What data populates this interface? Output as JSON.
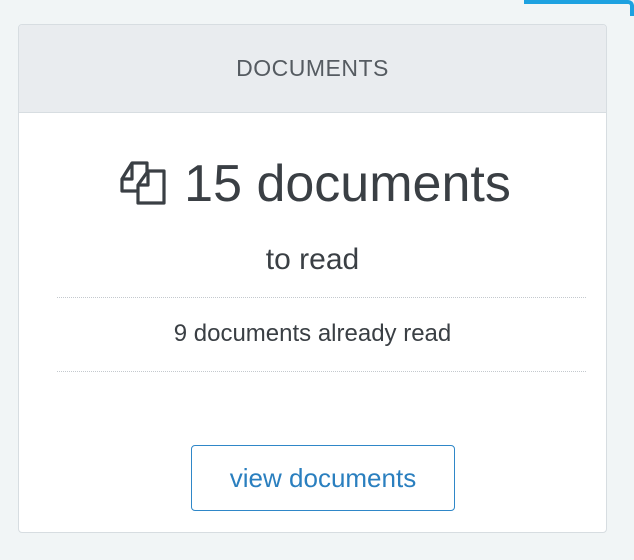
{
  "card": {
    "title": "DOCUMENTS",
    "icon": "copy-documents-icon",
    "count_label": "15 documents",
    "subtitle": "to read",
    "read_label": "9 documents already read",
    "button_label": "view documents"
  },
  "colors": {
    "accent": "#1da1e0",
    "button_text": "#2a7fbf",
    "header_bg": "#e9ecef"
  }
}
